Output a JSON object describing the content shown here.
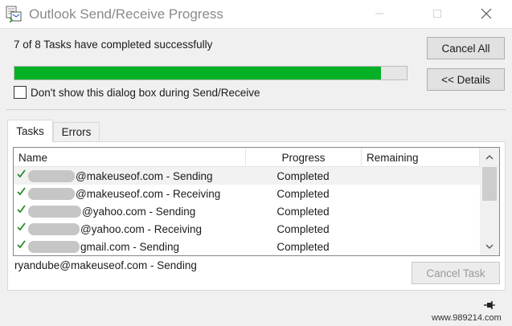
{
  "window": {
    "title": "Outlook Send/Receive Progress",
    "min_icon": "minimize-icon",
    "max_icon": "maximize-icon",
    "close_icon": "close-icon"
  },
  "status": {
    "text": "7 of 8 Tasks have completed successfully",
    "progress_fraction": 0.935,
    "progress_color": "#06b025"
  },
  "buttons": {
    "cancel_all": "Cancel All",
    "details": "<< Details",
    "cancel_task": "Cancel Task"
  },
  "checkbox": {
    "label": "Don't show this dialog box during Send/Receive",
    "checked": false
  },
  "tabs": [
    {
      "label": "Tasks",
      "active": true
    },
    {
      "label": "Errors",
      "active": false
    }
  ],
  "table": {
    "headers": {
      "name": "Name",
      "progress": "Progress",
      "remaining": "Remaining"
    },
    "rows": [
      {
        "name": "@makeuseof.com - Sending",
        "progress": "Completed",
        "remaining": "",
        "status_icon": "check-icon",
        "selected": true
      },
      {
        "name": "@makeuseof.com - Receiving",
        "progress": "Completed",
        "remaining": "",
        "status_icon": "check-icon",
        "selected": false
      },
      {
        "name": "@yahoo.com - Sending",
        "progress": "Completed",
        "remaining": "",
        "status_icon": "check-icon",
        "selected": false
      },
      {
        "name": "@yahoo.com - Receiving",
        "progress": "Completed",
        "remaining": "",
        "status_icon": "check-icon",
        "selected": false
      },
      {
        "name": "gmail.com - Sending",
        "progress": "Completed",
        "remaining": "",
        "status_icon": "check-icon",
        "selected": false
      }
    ]
  },
  "current_task": "ryandube@makeuseof.com - Sending",
  "watermark": "www.989214.com"
}
